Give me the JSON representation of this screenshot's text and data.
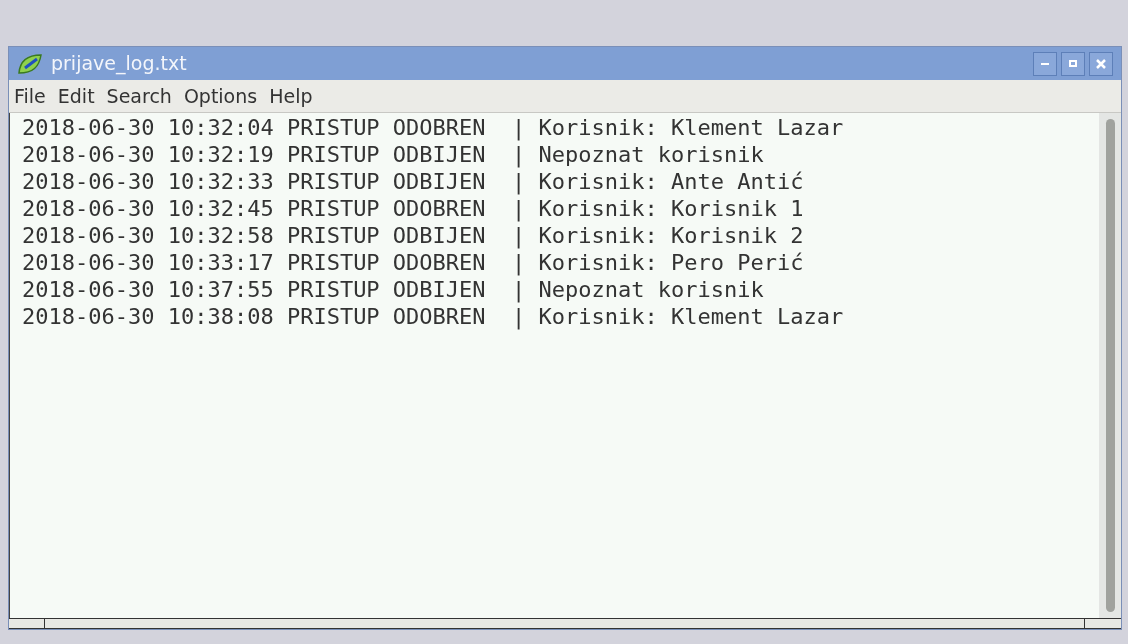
{
  "window": {
    "title": "prijave_log.txt"
  },
  "menu": [
    "File",
    "Edit",
    "Search",
    "Options",
    "Help"
  ],
  "lines": [
    "2018-06-30 10:32:04 PRISTUP ODOBREN  | Korisnik: Klement Lazar",
    "2018-06-30 10:32:19 PRISTUP ODBIJEN  | Nepoznat korisnik",
    "2018-06-30 10:32:33 PRISTUP ODBIJEN  | Korisnik: Ante Antić",
    "2018-06-30 10:32:45 PRISTUP ODOBREN  | Korisnik: Korisnik 1",
    "2018-06-30 10:32:58 PRISTUP ODBIJEN  | Korisnik: Korisnik 2",
    "2018-06-30 10:33:17 PRISTUP ODOBREN  | Korisnik: Pero Perić",
    "2018-06-30 10:37:55 PRISTUP ODBIJEN  | Nepoznat korisnik",
    "2018-06-30 10:38:08 PRISTUP ODOBREN  | Korisnik: Klement Lazar"
  ]
}
